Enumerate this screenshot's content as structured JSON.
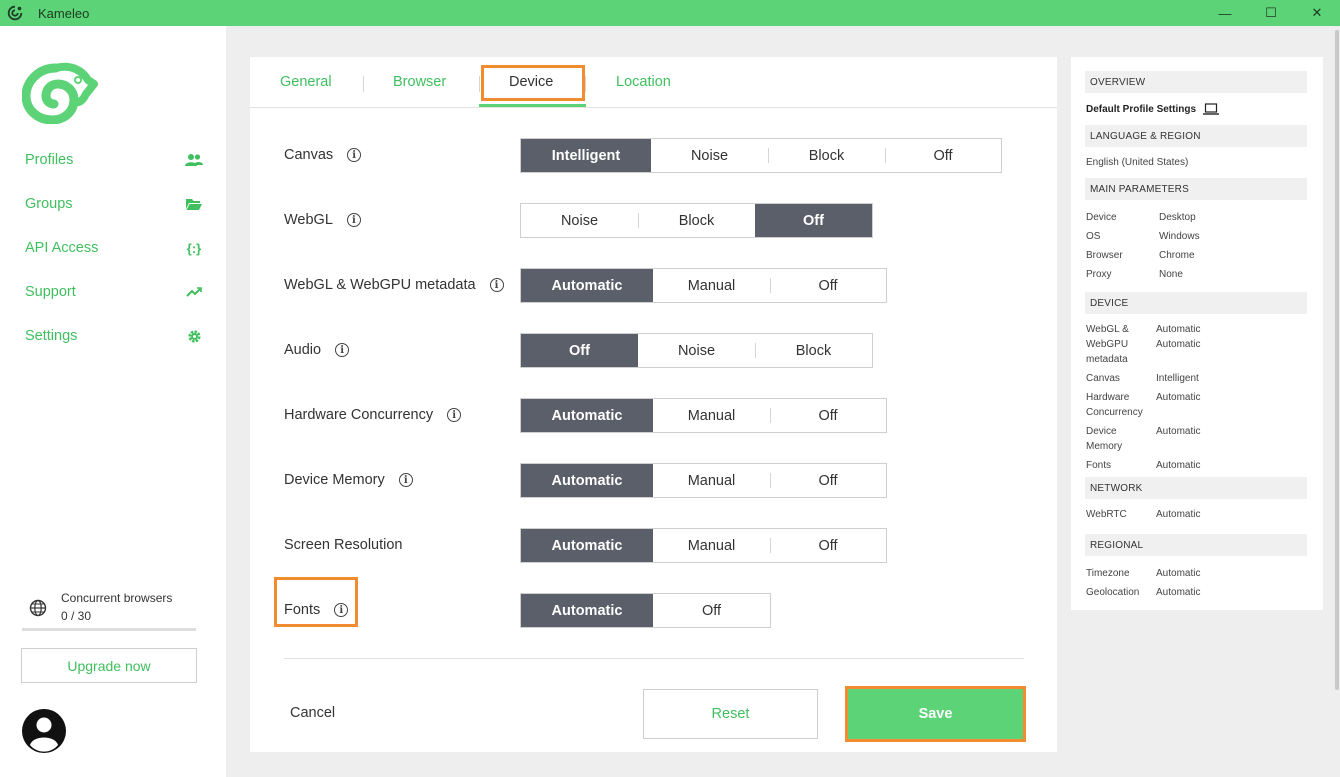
{
  "window": {
    "title": "Kameleo",
    "minimize": "—",
    "maximize": "☐",
    "close": "✕"
  },
  "sidebar": {
    "items": [
      {
        "label": "Profiles"
      },
      {
        "label": "Groups"
      },
      {
        "label": "API Access",
        "icon_text": "{:}"
      },
      {
        "label": "Support"
      },
      {
        "label": "Settings"
      }
    ],
    "concurrent_label": "Concurrent browsers",
    "concurrent_value": "0 / 30",
    "concurrent_fraction": 0,
    "upgrade_label": "Upgrade now"
  },
  "tabs": [
    {
      "label": "General"
    },
    {
      "label": "Browser"
    },
    {
      "label": "Device",
      "active": true
    },
    {
      "label": "Location"
    }
  ],
  "settings": [
    {
      "label": "Canvas",
      "info": true,
      "options": [
        "Intelligent",
        "Noise",
        "Block",
        "Off"
      ],
      "selected": "Intelligent"
    },
    {
      "label": "WebGL",
      "info": true,
      "options": [
        "Noise",
        "Block",
        "Off"
      ],
      "selected": "Off"
    },
    {
      "label": "WebGL & WebGPU metadata",
      "info": true,
      "options": [
        "Automatic",
        "Manual",
        "Off"
      ],
      "selected": "Automatic"
    },
    {
      "label": "Audio",
      "info": true,
      "options": [
        "Off",
        "Noise",
        "Block"
      ],
      "selected": "Off"
    },
    {
      "label": "Hardware Concurrency",
      "info": true,
      "options": [
        "Automatic",
        "Manual",
        "Off"
      ],
      "selected": "Automatic"
    },
    {
      "label": "Device Memory",
      "info": true,
      "options": [
        "Automatic",
        "Manual",
        "Off"
      ],
      "selected": "Automatic"
    },
    {
      "label": "Screen Resolution",
      "info": false,
      "options": [
        "Automatic",
        "Manual",
        "Off"
      ],
      "selected": "Automatic"
    },
    {
      "label": "Fonts",
      "info": true,
      "options": [
        "Automatic",
        "Off"
      ],
      "selected": "Automatic"
    }
  ],
  "footer": {
    "cancel": "Cancel",
    "reset": "Reset",
    "save": "Save"
  },
  "overview": {
    "overview_head": "OVERVIEW",
    "profile_name": "Default Profile Settings",
    "language_head": "LANGUAGE & REGION",
    "language_value": "English (United States)",
    "main_head": "MAIN PARAMETERS",
    "main_keys": "Device\nOS\nBrowser\nProxy",
    "main_values": "Desktop\nWindows\nChrome\nNone",
    "device_head": "DEVICE",
    "dev_webgl_key": "WebGL &\nWebGPU\nmetadata",
    "dev_webgl_val": "Automatic\nAutomatic",
    "dev_canvas_key": "Canvas",
    "dev_canvas_val": "Intelligent",
    "dev_hw_key": "Hardware\nConcurrency",
    "dev_hw_val": "Automatic",
    "dev_mem_key": "Device\nMemory",
    "dev_mem_val": "Automatic",
    "dev_fonts_key": "Fonts",
    "dev_fonts_val": "Automatic",
    "network_head": "NETWORK",
    "net_key": "WebRTC",
    "net_val": "Automatic",
    "regional_head": "REGIONAL",
    "reg_keys": "Timezone\nGeolocation",
    "reg_values": "Automatic\nAutomatic"
  },
  "colors": {
    "brand_green": "#5cd376",
    "text_green": "#3fbf5e",
    "selected_segment": "#5b5f6a",
    "highlight_orange": "#f28c30"
  }
}
